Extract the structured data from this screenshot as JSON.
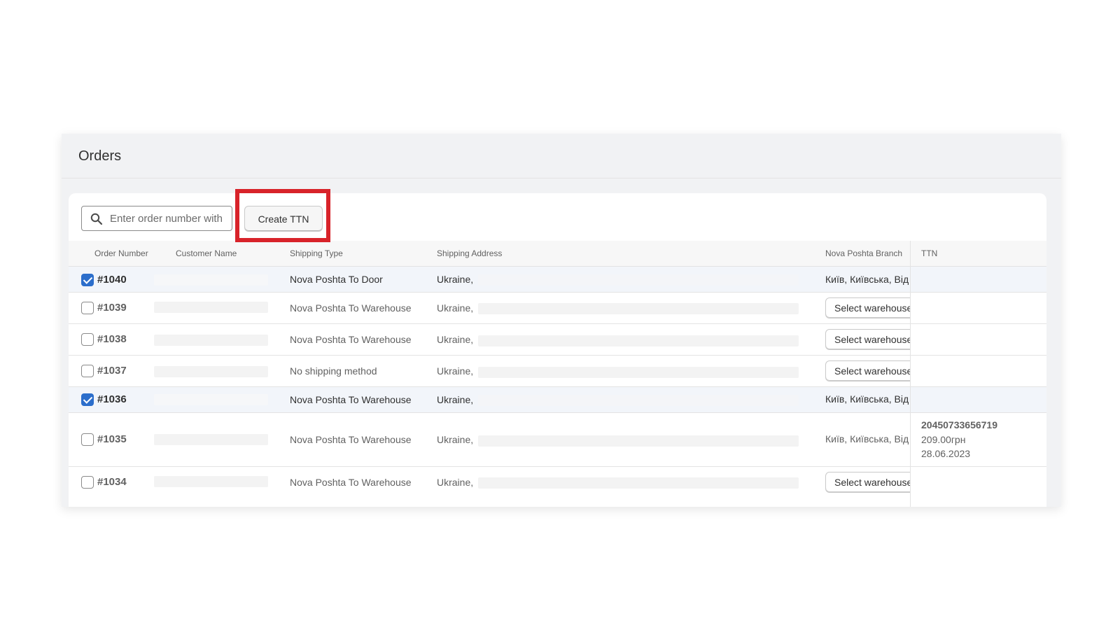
{
  "page": {
    "title": "Orders"
  },
  "toolbar": {
    "search_placeholder": "Enter order number with",
    "create_button": "Create TTN"
  },
  "table": {
    "headers": {
      "order_number": "Order Number",
      "customer_name": "Customer Name",
      "shipping_type": "Shipping Type",
      "shipping_address": "Shipping Address",
      "branch": "Nova Poshta Branch",
      "ttn": "TTN"
    },
    "rows": [
      {
        "order": "#1040",
        "checked": true,
        "shipping": "Nova Poshta To Door",
        "address_prefix": "Ukraine,",
        "branch": "Київ, Київська, Від",
        "branch_button": ""
      },
      {
        "order": "#1039",
        "checked": false,
        "shipping": "Nova Poshta To Warehouse",
        "address_prefix": "Ukraine,",
        "branch": "",
        "branch_button": "Select warehouse"
      },
      {
        "order": "#1038",
        "checked": false,
        "shipping": "Nova Poshta To Warehouse",
        "address_prefix": "Ukraine,",
        "branch": "",
        "branch_button": "Select warehouse"
      },
      {
        "order": "#1037",
        "checked": false,
        "shipping": "No shipping method",
        "address_prefix": "Ukraine,",
        "branch": "",
        "branch_button": "Select warehouse"
      },
      {
        "order": "#1036",
        "checked": true,
        "shipping": "Nova Poshta To Warehouse",
        "address_prefix": "Ukraine,",
        "branch": "Київ, Київська, Від",
        "branch_button": ""
      },
      {
        "order": "#1035",
        "checked": false,
        "shipping": "Nova Poshta To Warehouse",
        "address_prefix": "Ukraine,",
        "branch": "Київ, Київська, Від",
        "branch_button": "",
        "ttn": {
          "number": "20450733656719",
          "cost": "209.00грн",
          "date": "28.06.2023"
        }
      },
      {
        "order": "#1034",
        "checked": false,
        "shipping": "Nova Poshta To Warehouse",
        "address_prefix": "Ukraine,",
        "branch": "",
        "branch_button": "Select warehouse"
      }
    ]
  },
  "colors": {
    "accent": "#2c6ecb",
    "highlight": "#d8232a",
    "selected_row": "#f2f5fa"
  }
}
